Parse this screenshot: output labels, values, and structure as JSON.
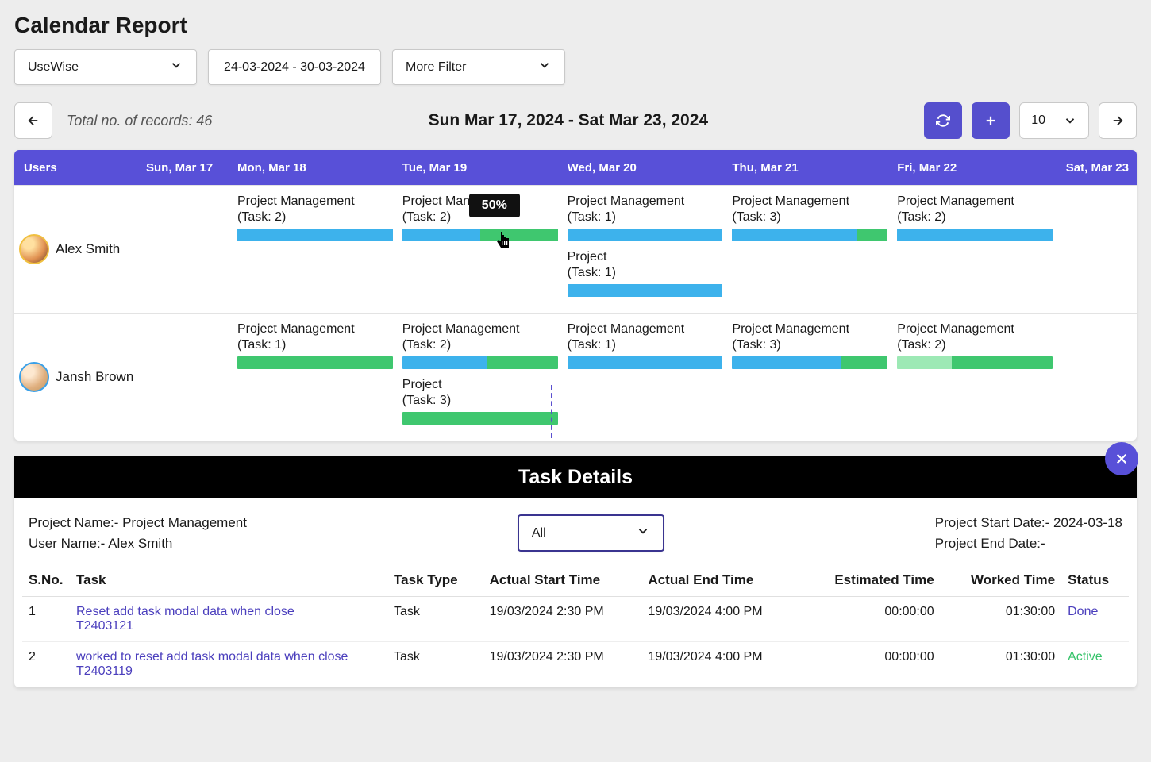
{
  "title": "Calendar Report",
  "filters": {
    "workspace": "UseWise",
    "daterange": "24-03-2024 - 30-03-2024",
    "more": "More Filter"
  },
  "records_label": "Total no. of records: 46",
  "week_label": "Sun Mar 17, 2024 - Sat Mar 23, 2024",
  "page_size": "10",
  "columns": {
    "users": "Users",
    "days": [
      "Sun, Mar 17",
      "Mon, Mar 18",
      "Tue, Mar 19",
      "Wed, Mar 20",
      "Thu, Mar 21",
      "Fri, Mar 22",
      "Sat, Mar 23"
    ]
  },
  "tooltip": "50%",
  "rows": [
    {
      "user": "Alex Smith",
      "cells": [
        [],
        [
          {
            "label": "Project Management",
            "tasks": "(Task: 2)",
            "segs": [
              [
                "c-blue",
                100
              ]
            ]
          }
        ],
        [
          {
            "label": "Project Management",
            "tasks": "(Task: 2)",
            "segs": [
              [
                "c-blue",
                50
              ],
              [
                "c-green",
                50
              ]
            ]
          }
        ],
        [
          {
            "label": "Project Management",
            "tasks": "(Task: 1)",
            "segs": [
              [
                "c-blue",
                100
              ]
            ]
          },
          {
            "label": "Project",
            "tasks": "(Task: 1)",
            "segs": [
              [
                "c-blue",
                100
              ]
            ]
          }
        ],
        [
          {
            "label": "Project Management",
            "tasks": "(Task: 3)",
            "segs": [
              [
                "c-blue",
                80
              ],
              [
                "c-green",
                20
              ]
            ]
          }
        ],
        [
          {
            "label": "Project Management",
            "tasks": "(Task: 2)",
            "segs": [
              [
                "c-blue",
                100
              ]
            ]
          }
        ],
        []
      ]
    },
    {
      "user": "Jansh Brown",
      "cells": [
        [],
        [
          {
            "label": "Project Management",
            "tasks": "(Task: 1)",
            "segs": [
              [
                "c-green",
                100
              ]
            ]
          }
        ],
        [
          {
            "label": "Project Management",
            "tasks": "(Task: 2)",
            "segs": [
              [
                "c-blue",
                55
              ],
              [
                "c-green",
                45
              ]
            ]
          },
          {
            "label": "Project",
            "tasks": "(Task: 3)",
            "segs": [
              [
                "c-green",
                100
              ]
            ]
          }
        ],
        [
          {
            "label": "Project Management",
            "tasks": "(Task: 1)",
            "segs": [
              [
                "c-blue",
                100
              ]
            ]
          }
        ],
        [
          {
            "label": "Project Management",
            "tasks": "(Task: 3)",
            "segs": [
              [
                "c-blue",
                70
              ],
              [
                "c-green",
                30
              ]
            ]
          }
        ],
        [
          {
            "label": "Project Management",
            "tasks": "(Task: 2)",
            "segs": [
              [
                "c-lgreen",
                35
              ],
              [
                "c-green",
                65
              ]
            ]
          }
        ],
        []
      ]
    }
  ],
  "details": {
    "title": "Task Details",
    "project_label": "Project Name:- Project Management",
    "user_label": "User Name:- Alex Smith",
    "filter_value": "All",
    "start_label": "Project Start Date:- 2024-03-18",
    "end_label": "Project End Date:-",
    "headers": {
      "sno": "S.No.",
      "task": "Task",
      "type": "Task Type",
      "start": "Actual Start Time",
      "end": "Actual End Time",
      "est": "Estimated Time",
      "worked": "Worked Time",
      "status": "Status"
    },
    "rows": [
      {
        "sno": "1",
        "task": "Reset add task modal data when close",
        "task_id": "T2403121",
        "type": "Task",
        "start": "19/03/2024 2:30 PM",
        "end": "19/03/2024 4:00 PM",
        "est": "00:00:00",
        "worked": "01:30:00",
        "status": "Done"
      },
      {
        "sno": "2",
        "task": "worked to reset add task modal data when close",
        "task_id": "T2403119",
        "type": "Task",
        "start": "19/03/2024 2:30 PM",
        "end": "19/03/2024 4:00 PM",
        "est": "00:00:00",
        "worked": "01:30:00",
        "status": "Active"
      }
    ]
  }
}
